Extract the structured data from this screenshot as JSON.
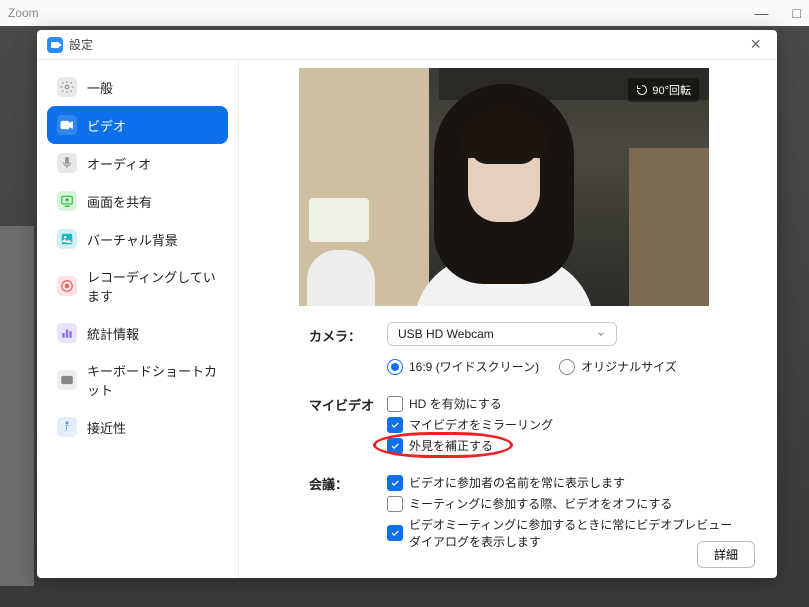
{
  "bg_window": {
    "title": "Zoom",
    "minimize": "—",
    "maximize": "□"
  },
  "dialog": {
    "title": "設定",
    "close": "×"
  },
  "sidebar": {
    "items": [
      {
        "label": "一般",
        "icon": "general"
      },
      {
        "label": "ビデオ",
        "icon": "video",
        "active": true
      },
      {
        "label": "オーディオ",
        "icon": "audio"
      },
      {
        "label": "画面を共有",
        "icon": "share"
      },
      {
        "label": "バーチャル背景",
        "icon": "virtual"
      },
      {
        "label": "レコーディングしています",
        "icon": "record"
      },
      {
        "label": "統計情報",
        "icon": "stats"
      },
      {
        "label": "キーボードショートカット",
        "icon": "kb"
      },
      {
        "label": "接近性",
        "icon": "access"
      }
    ]
  },
  "preview": {
    "rotate_label": "90°回転"
  },
  "camera": {
    "label": "カメラ：",
    "selected": "USB HD Webcam",
    "ratio_16_9": "16:9 (ワイドスクリーン)",
    "ratio_original": "オリジナルサイズ"
  },
  "myvideo": {
    "label": "マイビデオ",
    "hd": "HD を有効にする",
    "mirror": "マイビデオをミラーリング",
    "appearance": "外見を補正する"
  },
  "meeting": {
    "label": "会議：",
    "show_names": "ビデオに参加者の名前を常に表示します",
    "video_off": "ミーティングに参加する際、ビデオをオフにする",
    "preview_dialog": "ビデオミーティングに参加するときに常にビデオプレビューダイアログを表示します"
  },
  "footer": {
    "detail": "詳細"
  }
}
